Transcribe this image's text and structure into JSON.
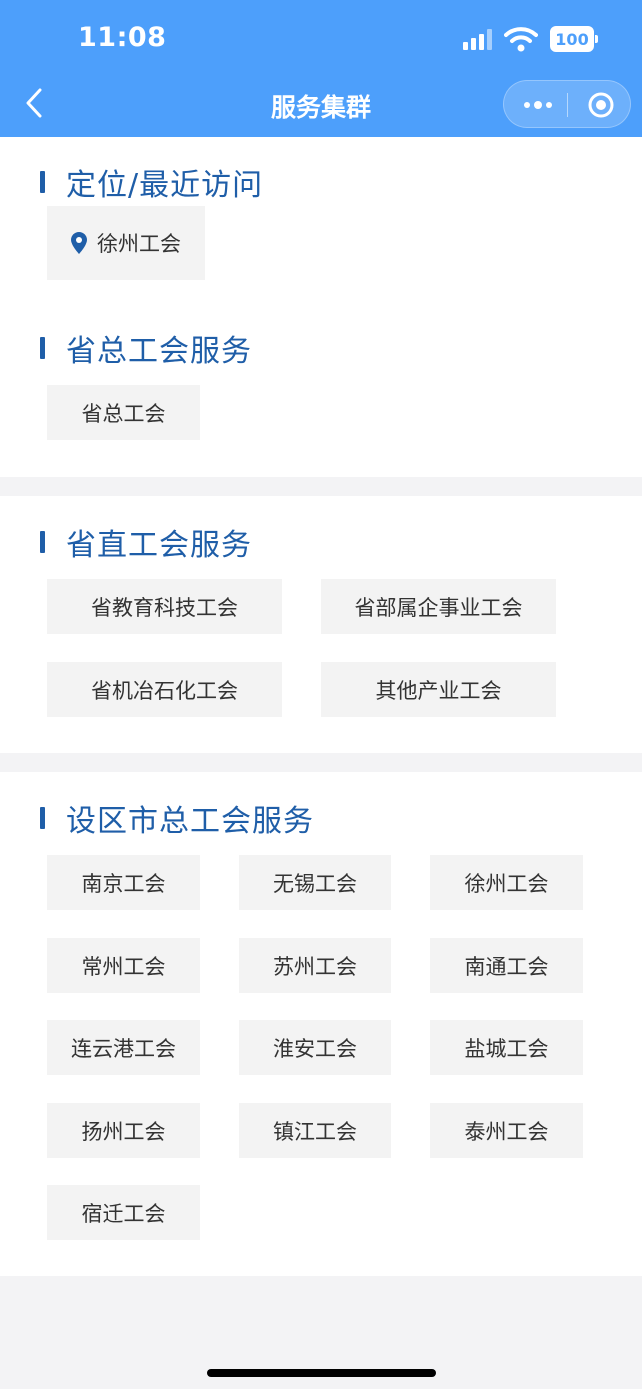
{
  "status_bar": {
    "time": "11:08",
    "battery": "100"
  },
  "nav": {
    "title": "服务集群"
  },
  "sections": {
    "recent": {
      "title": "定位/最近访问",
      "items": [
        "徐州工会"
      ]
    },
    "provincial": {
      "title": "省总工会服务",
      "items": [
        "省总工会"
      ]
    },
    "direct": {
      "title": "省直工会服务",
      "items": [
        "省教育科技工会",
        "省部属企事业工会",
        "省机冶石化工会",
        "其他产业工会"
      ]
    },
    "city": {
      "title": "设区市总工会服务",
      "items": [
        "南京工会",
        "无锡工会",
        "徐州工会",
        "常州工会",
        "苏州工会",
        "南通工会",
        "连云港工会",
        "淮安工会",
        "盐城工会",
        "扬州工会",
        "镇江工会",
        "泰州工会",
        "宿迁工会"
      ]
    }
  },
  "colors": {
    "nav_bg": "#4d9ffb",
    "accent": "#1f5ea8",
    "chip_bg": "#f3f3f3",
    "page_bg": "#f3f3f5"
  }
}
